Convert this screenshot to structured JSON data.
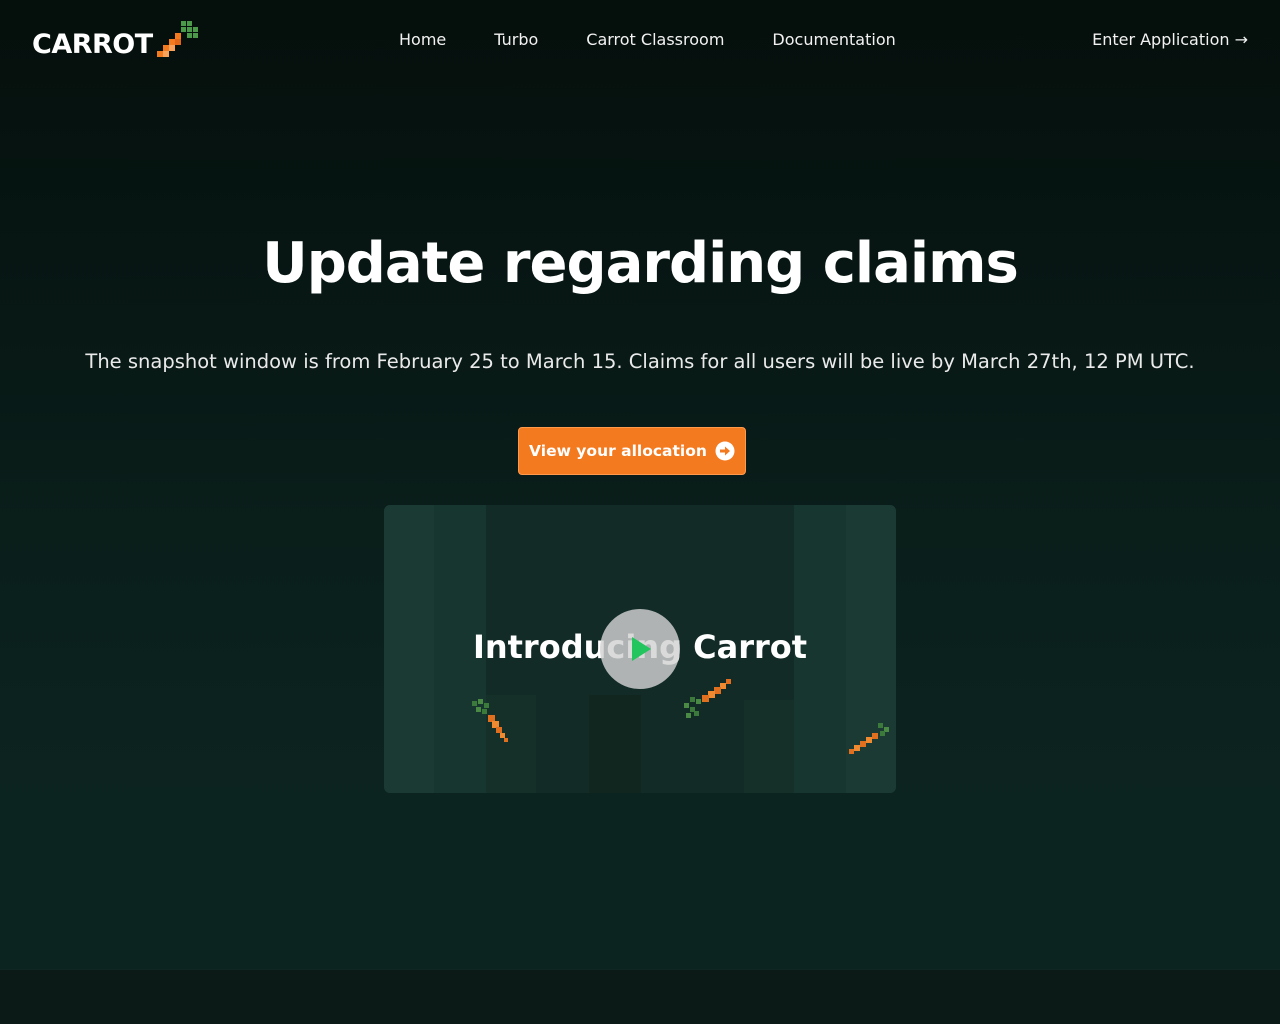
{
  "brand": {
    "name": "CARROT",
    "accent": "#f47a20",
    "leaf": "#4a9a4a"
  },
  "nav": {
    "items": [
      "Home",
      "Turbo",
      "Carrot Classroom",
      "Documentation"
    ],
    "enter_app": "Enter Application →"
  },
  "hero": {
    "title": "Update regarding claims",
    "subtitle": "The snapshot window is from February 25 to March 15. Claims for all users will be live by March 27th, 12 PM UTC.",
    "cta_label": "View your allocation",
    "cta_icon": "arrow-circle-right-icon"
  },
  "video": {
    "title": "Introducing Carrot",
    "play_icon": "play-icon"
  }
}
